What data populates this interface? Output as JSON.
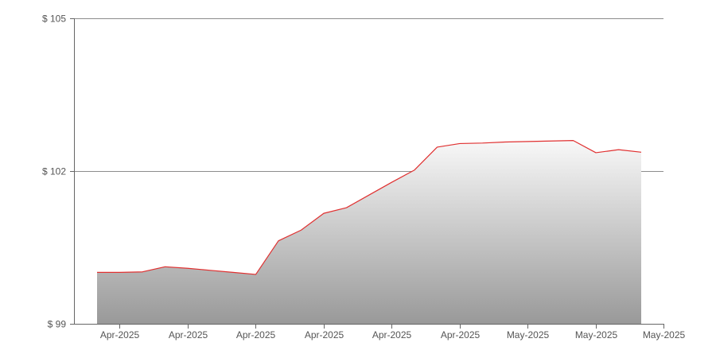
{
  "chart_data": {
    "type": "area",
    "title": "",
    "xlabel": "",
    "ylabel": "",
    "y_ticks": [
      {
        "value": 99,
        "label": "$ 99"
      },
      {
        "value": 102,
        "label": "$ 102"
      },
      {
        "value": 105,
        "label": "$ 105"
      }
    ],
    "ylim": [
      99,
      105
    ],
    "x_tick_labels": [
      "Apr-2025",
      "Apr-2025",
      "Apr-2025",
      "Apr-2025",
      "Apr-2025",
      "Apr-2025",
      "May-2025",
      "May-2025",
      "May-2025"
    ],
    "grid": {
      "horizontal": true,
      "vertical": false
    },
    "series": [
      {
        "values": [
          100.01,
          100.01,
          100.02,
          100.12,
          100.09,
          100.05,
          100.01,
          99.97,
          100.63,
          100.84,
          101.17,
          101.28,
          101.53,
          101.78,
          102.02,
          102.47,
          102.54,
          102.55,
          102.57,
          102.58,
          102.59,
          102.6,
          102.36,
          102.42,
          102.37
        ],
        "line_color": "#e03030",
        "fill_top_color": "#f8f8f8",
        "fill_bottom_color": "#999999"
      }
    ]
  }
}
